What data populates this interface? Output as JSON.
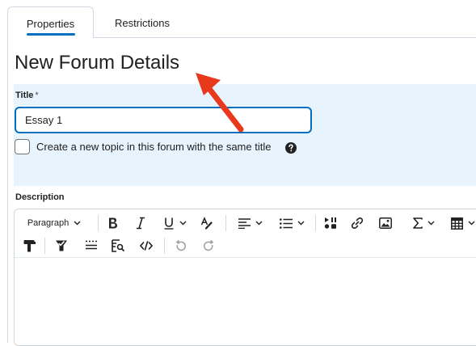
{
  "tabs": [
    {
      "label": "Properties",
      "active": true
    },
    {
      "label": "Restrictions",
      "active": false
    }
  ],
  "page_title": "New Forum Details",
  "form": {
    "title_label": "Title",
    "required_marker": "*",
    "title_value": "Essay 1",
    "checkbox_label": "Create a new topic in this forum with the same title",
    "checkbox_checked": false,
    "description_label": "Description"
  },
  "editor": {
    "block_format": "Paragraph",
    "toolbar_icons": [
      "bold-icon",
      "italic-icon",
      "underline-icon",
      "text-style-icon",
      "align-icon",
      "list-icon",
      "insert-media-icon",
      "link-icon",
      "image-icon",
      "equation-icon",
      "table-icon",
      "format-painter-icon",
      "spellcheck-icon",
      "horizontal-rule-icon",
      "find-replace-icon",
      "source-code-icon",
      "undo-icon",
      "redo-icon"
    ]
  },
  "colors": {
    "accent": "#006fbf",
    "panel": "#e8f4fd",
    "annotation_arrow": "#e8391d"
  }
}
